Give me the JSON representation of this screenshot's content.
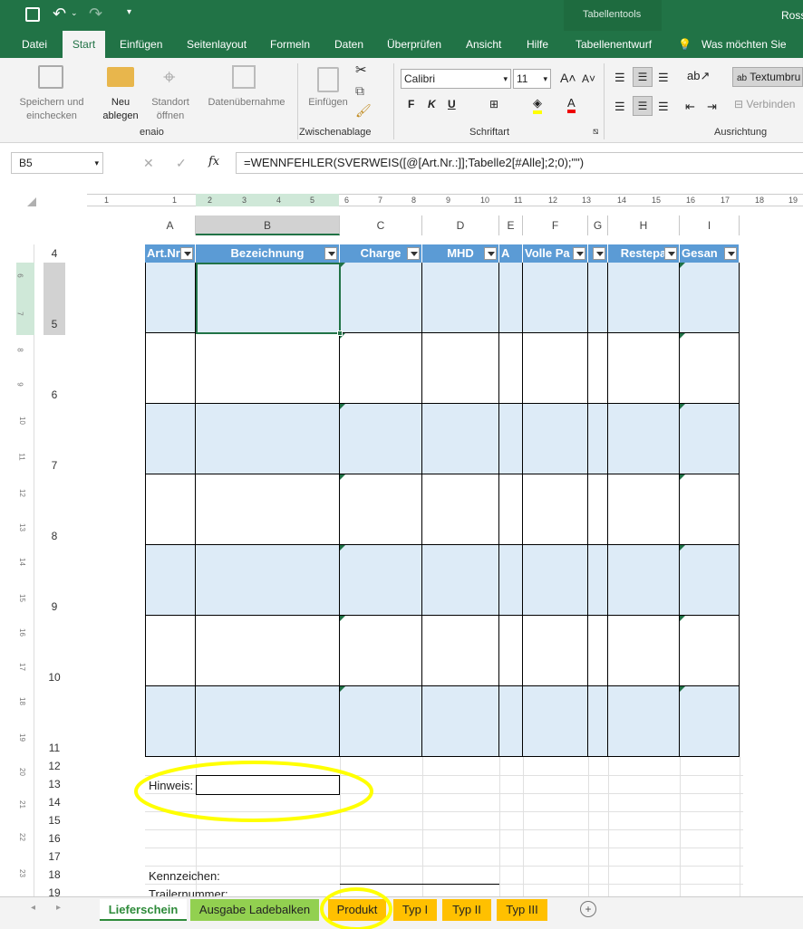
{
  "titlebar": {
    "context_title": "Tabellentools",
    "user": "Ross"
  },
  "tabs": [
    "Datei",
    "Start",
    "Einfügen",
    "Seitenlayout",
    "Formeln",
    "Daten",
    "Überprüfen",
    "Ansicht",
    "Hilfe",
    "Tabellenentwurf"
  ],
  "tellme": "Was möchten Sie tun",
  "ribbon": {
    "save_check": "Speichern und einchecken",
    "neu_ablegen": "Neu ablegen",
    "standort": "Standort öffnen",
    "datenuebernahme": "Datenübernahme",
    "einfuegen": "Einfügen",
    "group_enaio": "enaio",
    "group_zwischen": "Zwischenablage",
    "group_schrift": "Schriftart",
    "group_ausrichtung": "Ausrichtung",
    "font_name": "Calibri",
    "font_size": "11",
    "textumbruch": "Textumbru",
    "verbinden": "Verbinden"
  },
  "formula_bar": {
    "name_box": "B5",
    "formula": "=WENNFEHLER(SVERWEIS([@[Art.Nr.:]];Tabelle2[#Alle];2;0);\"\")"
  },
  "ruler_marks": [
    "1",
    "1",
    "2",
    "3",
    "4",
    "5",
    "6",
    "7",
    "8",
    "9",
    "10",
    "11",
    "12",
    "13",
    "14",
    "15",
    "16",
    "17",
    "18",
    "19"
  ],
  "vruler_marks": [
    "6",
    "7",
    "8",
    "9",
    "10",
    "11",
    "12",
    "13",
    "14",
    "15",
    "16",
    "17",
    "18",
    "19",
    "20",
    "21",
    "22",
    "23"
  ],
  "columns": [
    "A",
    "B",
    "C",
    "D",
    "E",
    "F",
    "G",
    "H",
    "I"
  ],
  "rows": [
    "4",
    "5",
    "6",
    "7",
    "8",
    "9",
    "10",
    "11",
    "12",
    "13",
    "14",
    "15",
    "16",
    "17",
    "18",
    "19"
  ],
  "table_headers": [
    "Art.Nr",
    "Bezeichnung",
    "Charge",
    "MHD",
    "A",
    "Volle Pa",
    "",
    "Restepa",
    "Gesan"
  ],
  "labels": {
    "hinweis": "Hinweis:",
    "kennzeichen": "Kennzeichen:",
    "trailer": "Trailernummer:"
  },
  "sheet_tabs": [
    "Lieferschein",
    "Ausgabe Ladebalken",
    "Produkt",
    "Typ I",
    "Typ II",
    "Typ III"
  ],
  "colors": {
    "excel_green": "#217346",
    "table_header": "#5b9bd5",
    "band": "#ddebf7",
    "highlight": "#ffff00",
    "tab_orange": "#ffc000",
    "tab_green": "#92d050"
  }
}
